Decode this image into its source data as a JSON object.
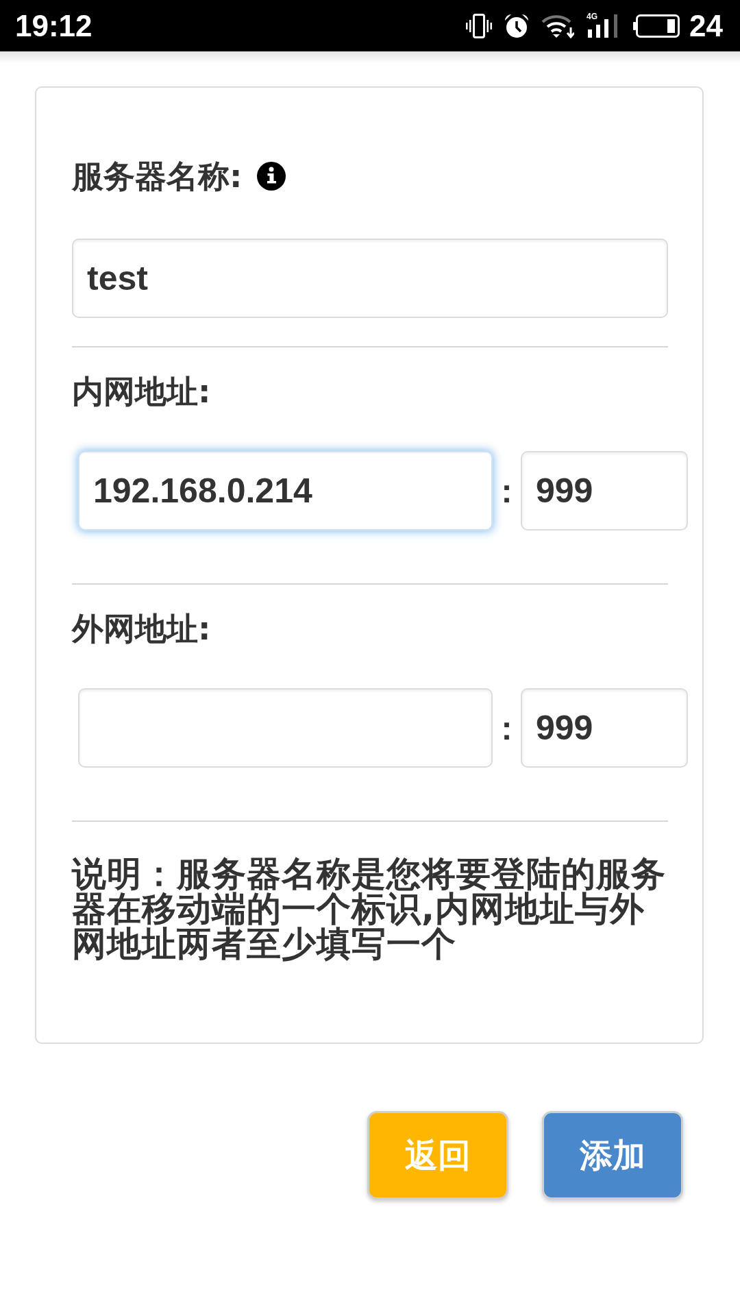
{
  "status_bar": {
    "time": "19:12",
    "network": "4G",
    "battery_percent": "24"
  },
  "sections": [
    {
      "kind": "text",
      "label": "服务器名称:",
      "info": true,
      "value": "test",
      "focused": false
    },
    {
      "kind": "address",
      "label": "内网地址:",
      "info": false,
      "host": {
        "value": "192.168.0.214",
        "focused": true
      },
      "separator": ":",
      "port": {
        "value": "999",
        "focused": false
      }
    },
    {
      "kind": "address",
      "label": "外网地址:",
      "info": false,
      "host": {
        "focused": false
      },
      "separator": ":",
      "port": {
        "value": "999",
        "focused": false
      }
    }
  ],
  "note": "说明：服务器名称是您将要登陆的服务器在移动端的一个标识,内网地址与外网地址两者至少填写一个",
  "buttons": [
    {
      "label": "返回",
      "color": "#ffb600"
    },
    {
      "label": "添加",
      "color": "#4a88cc"
    }
  ]
}
